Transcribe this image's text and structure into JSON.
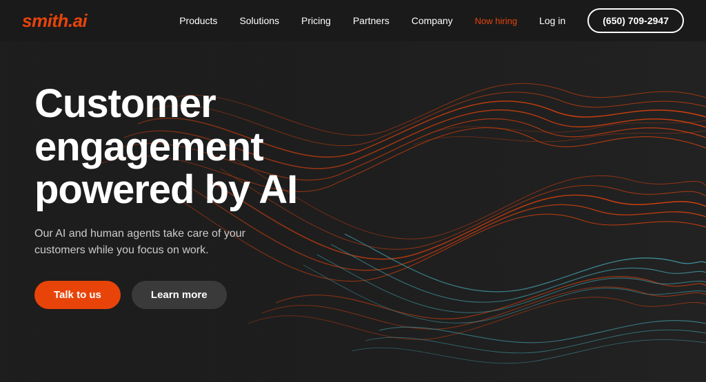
{
  "brand": {
    "logo": "smith.ai"
  },
  "nav": {
    "items": [
      {
        "id": "products",
        "label": "Products"
      },
      {
        "id": "solutions",
        "label": "Solutions"
      },
      {
        "id": "pricing",
        "label": "Pricing"
      },
      {
        "id": "partners",
        "label": "Partners"
      },
      {
        "id": "company",
        "label": "Company"
      }
    ],
    "hiring_label": "Now hiring",
    "login_label": "Log in",
    "phone_label": "(650) 709-2947"
  },
  "hero": {
    "title": "Customer engagement powered by AI",
    "subtitle": "Our AI and human agents take care of your customers while you focus on work.",
    "cta_primary": "Talk to us",
    "cta_secondary": "Learn more"
  },
  "colors": {
    "accent": "#e8440a",
    "bg": "#1e1e1e",
    "text_primary": "#ffffff",
    "text_secondary": "#cccccc"
  }
}
